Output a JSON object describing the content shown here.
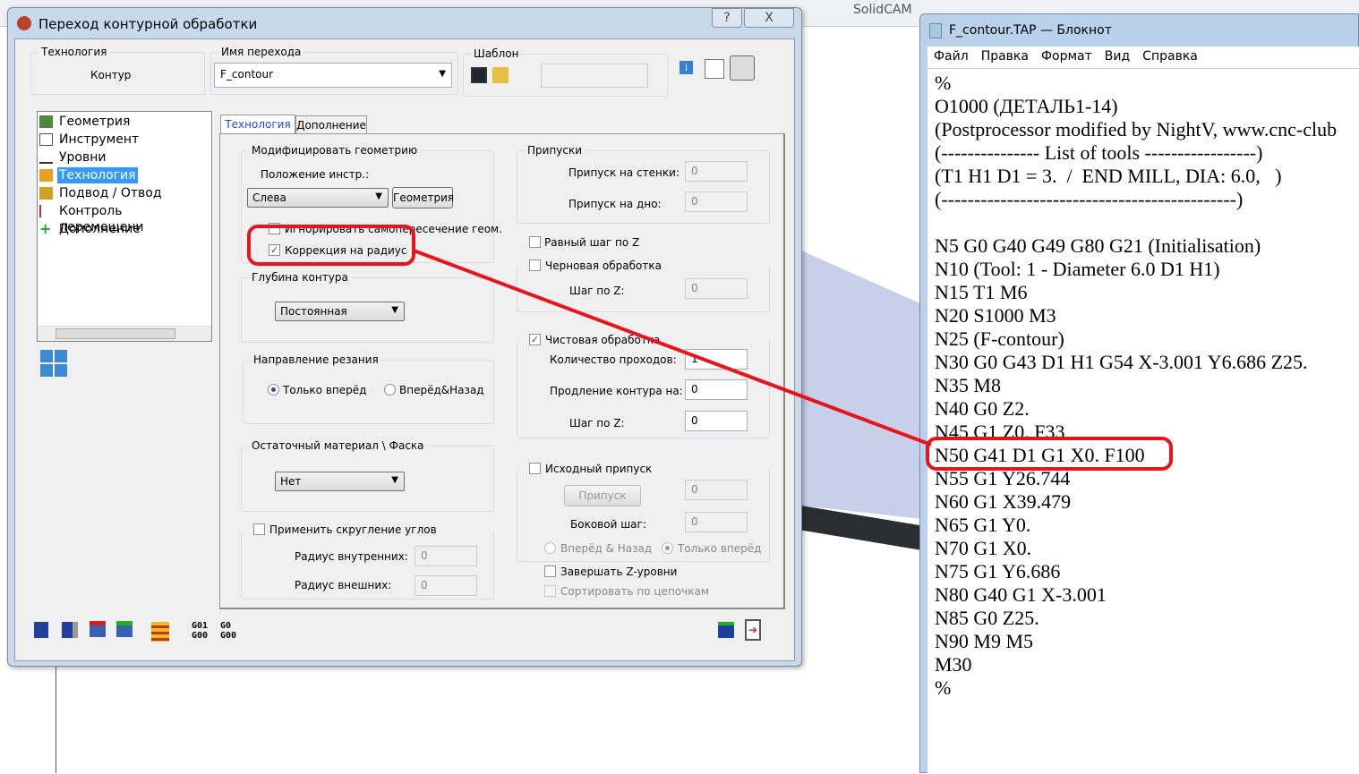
{
  "background_app": {
    "name": "SolidCAM"
  },
  "dialog": {
    "title": "Переход контурной обработки",
    "help": "?",
    "close": "X",
    "technology": {
      "label": "Технология",
      "value": "Контур"
    },
    "operation_name": {
      "label": "Имя перехода",
      "value": "F_contour"
    },
    "template": {
      "label": "Шаблон",
      "value": ""
    },
    "tree": [
      "Геометрия",
      "Инструмент",
      "Уровни",
      "Технология",
      "Подвод / Отвод",
      "Контроль перемещени",
      "Дополнение"
    ],
    "tree_selected": "Технология",
    "tabs": [
      "Технология",
      "Дополнение"
    ],
    "active_tab": "Технология",
    "modify": {
      "label": "Модифицировать геометрию",
      "tool_pos_label": "Положение инстр.:",
      "tool_pos": "Слева",
      "geometry_btn": "Геометрия",
      "ignore_self": "Игнорировать самопересечение геом.",
      "ignore_checked": false,
      "radius_comp": "Коррекция на радиус",
      "radius_checked": true
    },
    "depth": {
      "label": "Глубина контура",
      "value": "Постоянная"
    },
    "direction": {
      "label": "Направление резания",
      "forward": "Только вперёд",
      "both": "Вперёд&Назад",
      "selected": "Только вперёд"
    },
    "rest": {
      "label": "Остаточный материал \\ Фаска",
      "value": "Нет"
    },
    "corner": {
      "label": "Применить скругление углов",
      "checked": false,
      "inner_label": "Радиус внутренних:",
      "inner": "0",
      "outer_label": "Радиус внешних:",
      "outer": "0"
    },
    "offsets": {
      "label": "Припуски",
      "wall_label": "Припуск на стенки:",
      "wall": "0",
      "floor_label": "Припуск на дно:",
      "floor": "0"
    },
    "equal_step": {
      "label": "Равный шаг по Z",
      "checked": false
    },
    "rough": {
      "label": "Черновая обработка",
      "checked": false,
      "step_label": "Шаг по Z:",
      "step": "0"
    },
    "finish": {
      "label": "Чистовая обработка",
      "checked": true,
      "passes_label": "Количество проходов:",
      "passes": "1",
      "extend_label": "Продление контура на:",
      "extend": "0",
      "step_label": "Шаг по Z:",
      "step": "0"
    },
    "initial": {
      "label": "Исходный припуск",
      "checked": false,
      "btn": "Припуск",
      "value": "0",
      "side_label": "Боковой шаг:",
      "side": "0",
      "both": "Вперёд & Назад",
      "forward": "Только вперёд"
    },
    "finish_z": {
      "label": "Завершать Z-уровни",
      "checked": false
    },
    "sort": {
      "label": "Сортировать по цепочкам",
      "checked": false
    },
    "toolbar": {
      "g1": "G01",
      "g2": "G00",
      "g3": "G0",
      "g4": "G00"
    }
  },
  "notepad": {
    "title": "F_contour.TAP — Блокнот",
    "menu": [
      "Файл",
      "Правка",
      "Формат",
      "Вид",
      "Справка"
    ],
    "lines": [
      "%",
      "O1000 (ДЕТАЛЬ1-14)",
      "(Postprocessor modified by NightV, www.cnc-club",
      "(--------------- List of tools -----------------)",
      "(T1 H1 D1 = 3.  /  END MILL, DIA: 6.0,   )",
      "(---------------------------------------------)",
      "",
      "N5 G0 G40 G49 G80 G21 (Initialisation)",
      "N10 (Tool: 1 - Diameter 6.0 D1 H1)",
      "N15 T1 M6",
      "N20 S1000 M3",
      "N25 (F-contour)",
      "N30 G0 G43 D1 H1 G54 X-3.001 Y6.686 Z25.",
      "N35 M8",
      "N40 G0 Z2.",
      "N45 G1 Z0. F33",
      "N50 G41 D1 G1 X0. F100",
      "N55 G1 Y26.744",
      "N60 G1 X39.479",
      "N65 G1 Y0.",
      "N70 G1 X0.",
      "N75 G1 Y6.686",
      "N80 G40 G1 X-3.001",
      "N85 G0 Z25.",
      "N90 M9 M5",
      "M30",
      "%"
    ]
  },
  "annotation_color": "#e8141c"
}
